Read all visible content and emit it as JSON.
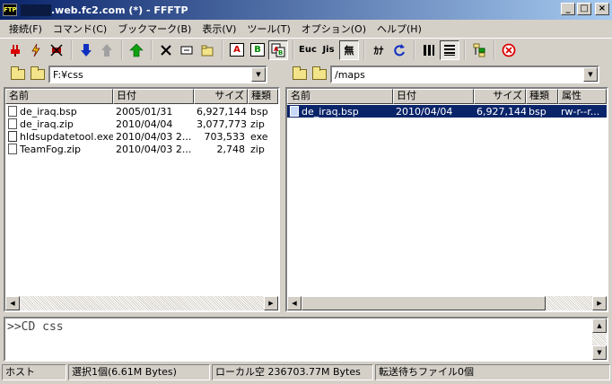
{
  "window": {
    "title": ".web.fc2.com (*) - FFFTP",
    "app_icon_label": "FTP",
    "controls": [
      "_",
      "□",
      "×"
    ]
  },
  "menu": [
    "接続(F)",
    "コマンド(C)",
    "ブックマーク(B)",
    "表示(V)",
    "ツール(T)",
    "オプション(O)",
    "ヘルプ(H)"
  ],
  "toolbar": {
    "ascii_label": "A",
    "binary_label": "B",
    "euc_label": "Euc",
    "jis_label": "Jis",
    "nochange_label": "無",
    "kana_label": "ｶﾅ"
  },
  "local": {
    "path": "F:¥css",
    "columns": [
      "名前",
      "日付",
      "サイズ",
      "種類"
    ],
    "files": [
      {
        "name": "de_iraq.bsp",
        "date": "2005/01/31",
        "size": "6,927,144",
        "type": "bsp"
      },
      {
        "name": "de_iraq.zip",
        "date": "2010/04/04",
        "size": "3,077,773",
        "type": "zip"
      },
      {
        "name": "hldsupdatetool.exe",
        "date": "2010/04/03 2...",
        "size": "703,533",
        "type": "exe"
      },
      {
        "name": "TeamFog.zip",
        "date": "2010/04/03 2...",
        "size": "2,748",
        "type": "zip"
      }
    ]
  },
  "remote": {
    "path": "/maps",
    "columns": [
      "名前",
      "日付",
      "サイズ",
      "種類",
      "属性"
    ],
    "files": [
      {
        "name": "de_iraq.bsp",
        "date": "2010/04/04",
        "size": "6,927,144",
        "type": "bsp",
        "attr": "rw-r--r..."
      }
    ]
  },
  "log": {
    "text": ">>CD css"
  },
  "status": {
    "host": "ホスト",
    "selection": "選択1個(6.61M Bytes)",
    "local_free": "ローカル空 236703.77M Bytes",
    "queue": "転送待ちファイル0個"
  }
}
